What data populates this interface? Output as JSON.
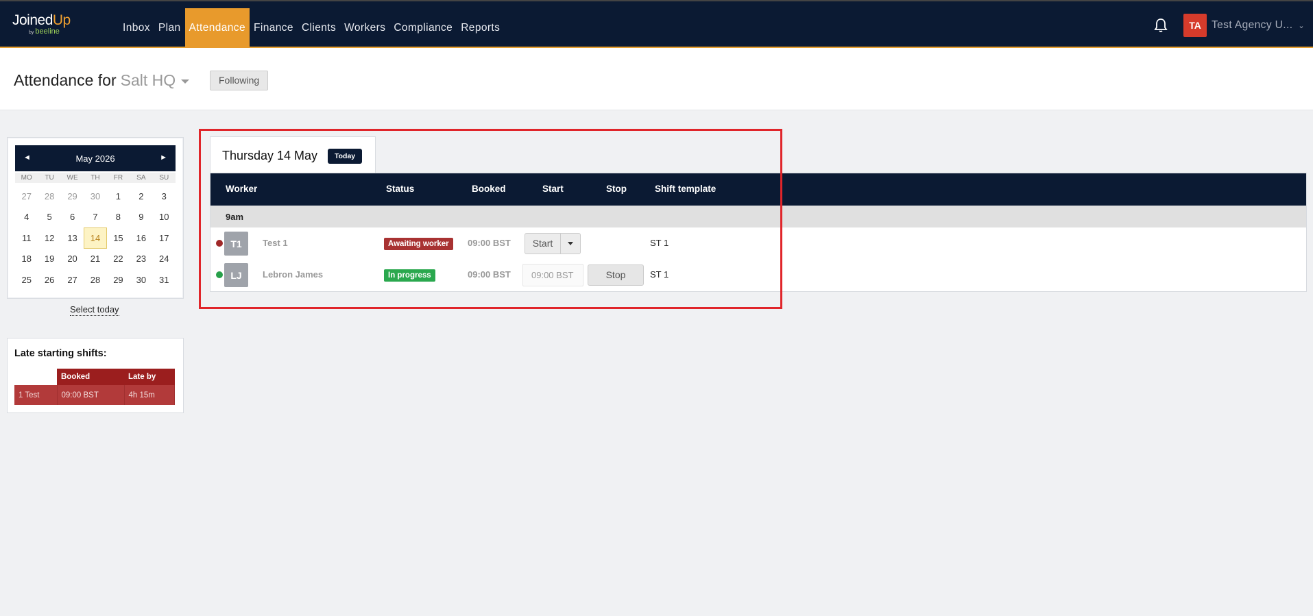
{
  "brand": {
    "joined": "Joined",
    "up": "Up",
    "by": "by",
    "beeline": "beeline"
  },
  "nav": [
    {
      "label": "Inbox",
      "active": false
    },
    {
      "label": "Plan",
      "active": false
    },
    {
      "label": "Attendance",
      "active": true
    },
    {
      "label": "Finance",
      "active": false
    },
    {
      "label": "Clients",
      "active": false
    },
    {
      "label": "Workers",
      "active": false
    },
    {
      "label": "Compliance",
      "active": false
    },
    {
      "label": "Reports",
      "active": false
    }
  ],
  "user": {
    "initials": "TA",
    "name": "Test Agency U..."
  },
  "header": {
    "title_prefix": "Attendance for",
    "site": "Salt HQ",
    "following": "Following"
  },
  "calendar": {
    "month": "May 2026",
    "prev": "◄",
    "next": "►",
    "dow": [
      "MO",
      "TU",
      "WE",
      "TH",
      "FR",
      "SA",
      "SU"
    ],
    "days": [
      "27",
      "28",
      "29",
      "30",
      "1",
      "2",
      "3",
      "4",
      "5",
      "6",
      "7",
      "8",
      "9",
      "10",
      "11",
      "12",
      "13",
      "14",
      "15",
      "16",
      "17",
      "18",
      "19",
      "20",
      "21",
      "22",
      "23",
      "24",
      "25",
      "26",
      "27",
      "28",
      "29",
      "30",
      "31"
    ],
    "muted_count": 4,
    "selected": "14",
    "select_today": "Select today"
  },
  "late": {
    "title": "Late starting shifts:",
    "headers": [
      "",
      "Booked",
      "Late by"
    ],
    "rows": [
      [
        "1 Test",
        "09:00 BST",
        "4h 15m"
      ]
    ]
  },
  "day": {
    "title": "Thursday 14 May",
    "today_badge": "Today"
  },
  "table": {
    "headers": {
      "worker": "Worker",
      "status": "Status",
      "booked": "Booked",
      "start": "Start",
      "stop": "Stop",
      "template": "Shift template"
    },
    "group": "9am",
    "rows": [
      {
        "dot_color": "#a02828",
        "initials": "T1",
        "name": "Test 1",
        "status": "Awaiting worker",
        "status_color": "#a83232",
        "booked": "09:00 BST",
        "start_label": "Start",
        "template": "ST 1"
      },
      {
        "dot_color": "#27a04a",
        "initials": "LJ",
        "name": "Lebron James",
        "status": "In progress",
        "status_color": "#2aa84e",
        "booked": "09:00 BST",
        "start_time": "09:00 BST",
        "stop_label": "Stop",
        "template": "ST 1"
      }
    ]
  }
}
